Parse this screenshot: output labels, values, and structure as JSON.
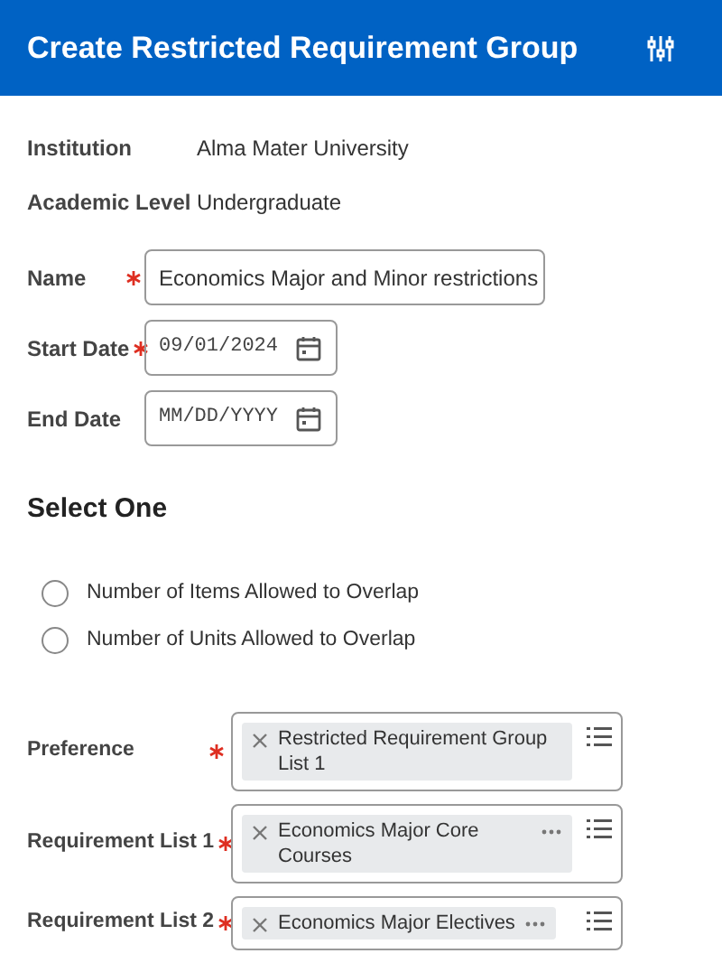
{
  "header": {
    "title": "Create Restricted Requirement Group"
  },
  "info": [
    {
      "label": "Institution",
      "value": "Alma Mater University"
    },
    {
      "label": "Academic Level",
      "value": "Undergraduate"
    }
  ],
  "fields": [
    {
      "kind": "text",
      "label": "Name",
      "required": true,
      "value": "Economics Major and Minor restrictions"
    },
    {
      "kind": "date",
      "label": "Start Date",
      "required": true,
      "value": "09/01/2024"
    },
    {
      "kind": "date",
      "label": "End Date",
      "required": false,
      "placeholder": "MM/DD/YYYY"
    }
  ],
  "select_section": {
    "title": "Select One",
    "options": [
      {
        "label": "Number of Items Allowed to Overlap",
        "selected": false
      },
      {
        "label": "Number of Units Allowed to Overlap",
        "selected": false
      }
    ]
  },
  "prompts": [
    {
      "label": "Preference",
      "required": true,
      "chip": "Restricted Requirement Group List 1",
      "more": false
    },
    {
      "label": "Requirement List 1",
      "required": true,
      "chip": "Economics Major Core Courses",
      "more": true
    },
    {
      "label": "Requirement List 2",
      "required": true,
      "chip": "Economics Major Electives",
      "more": true
    }
  ]
}
